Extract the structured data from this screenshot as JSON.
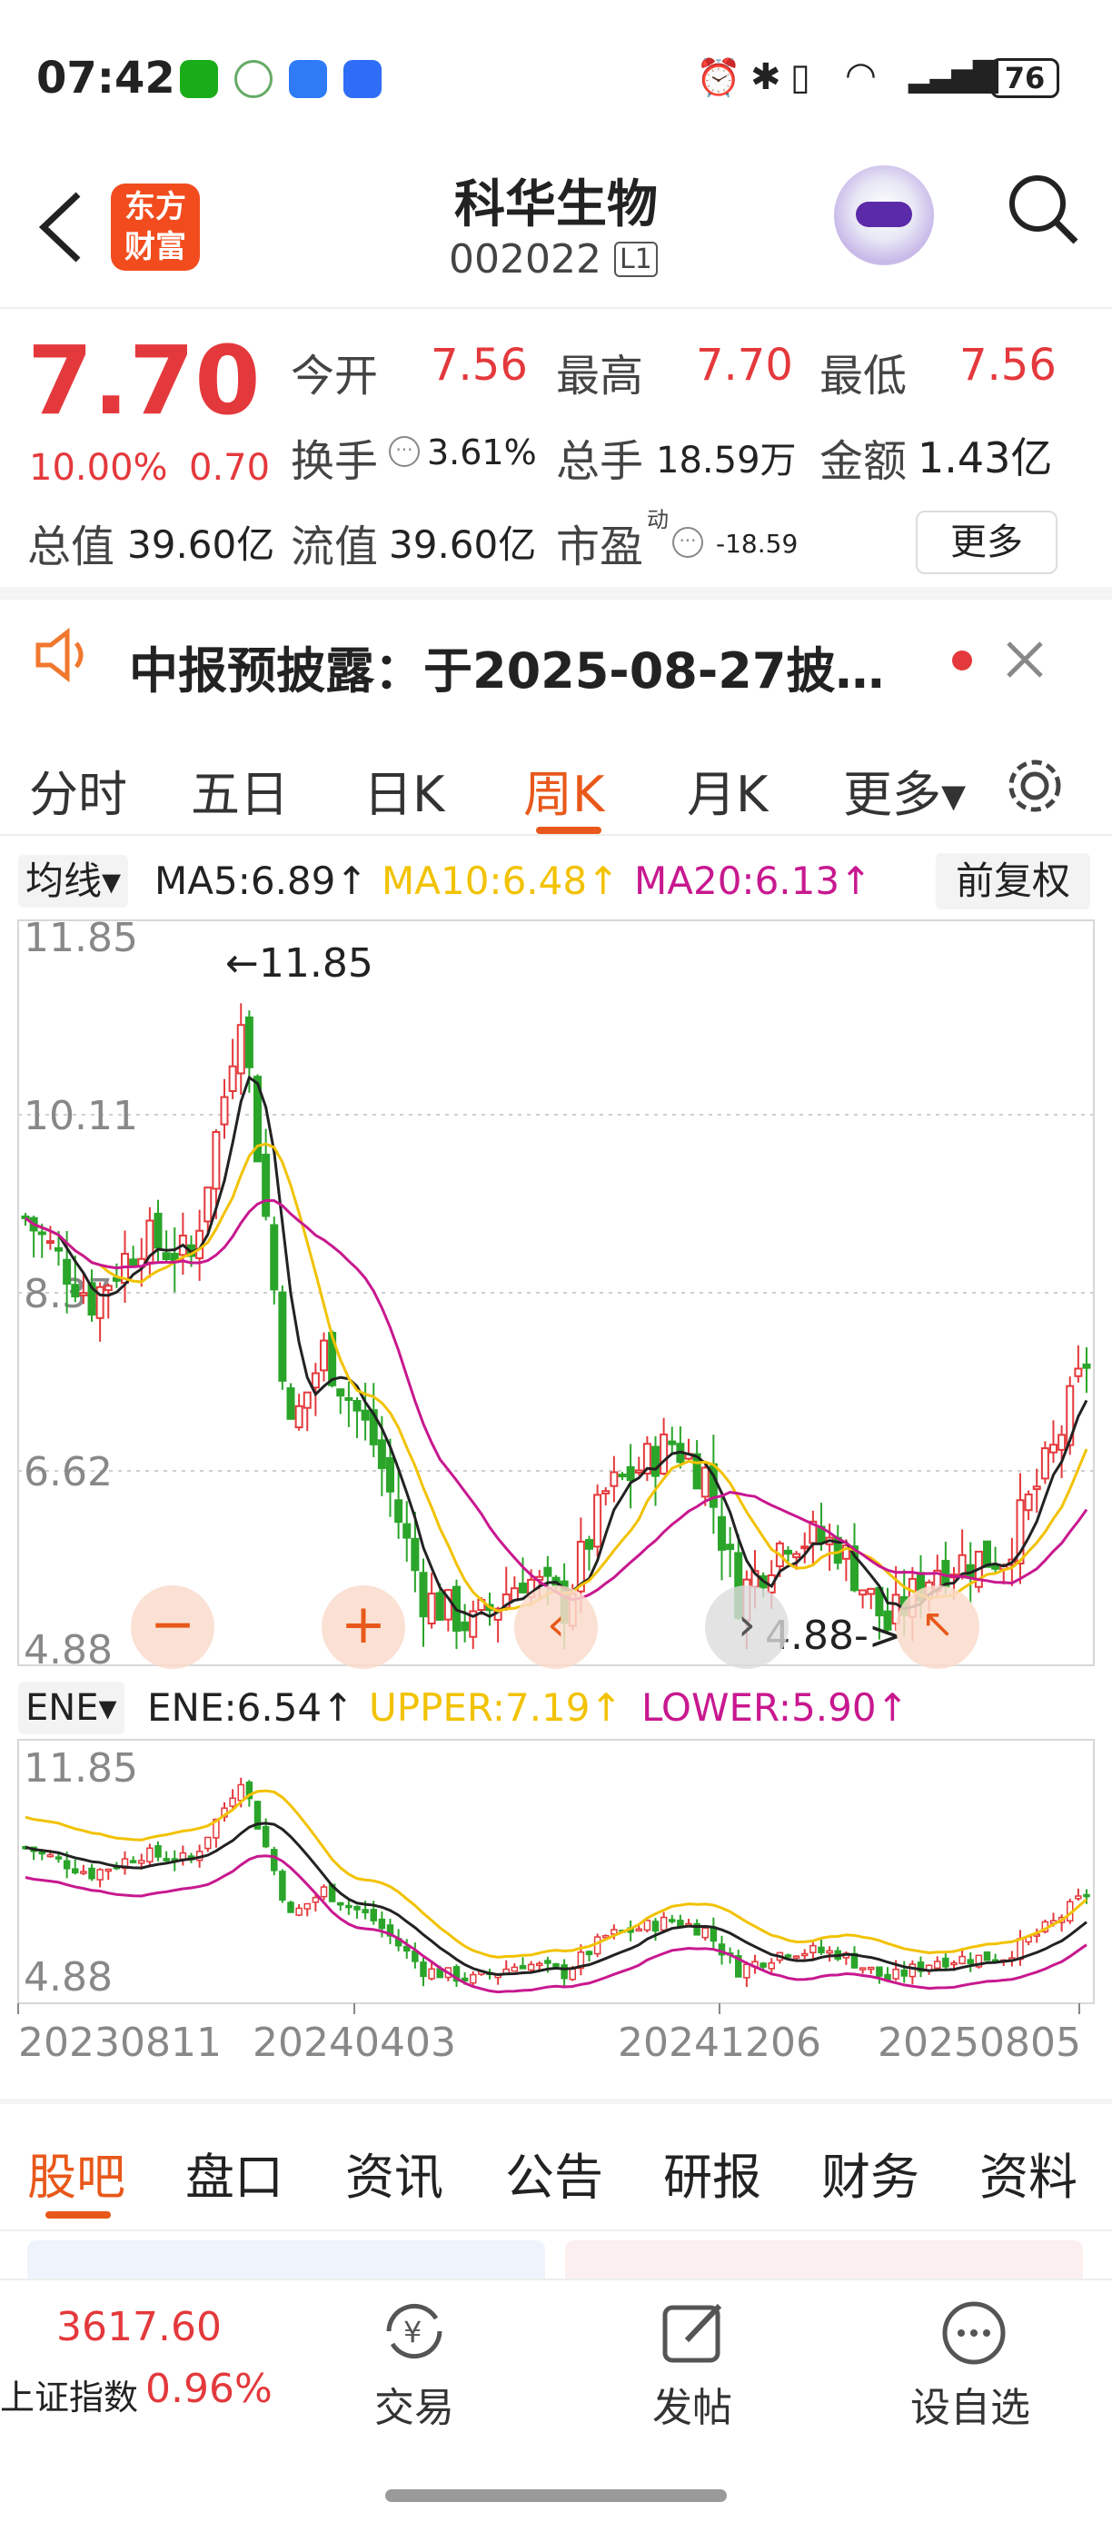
{
  "status": {
    "time": "07:42",
    "battery": "76"
  },
  "header": {
    "logo_line1": "东方",
    "logo_line2": "财富",
    "name": "科华生物",
    "code": "002022",
    "level": "L1"
  },
  "quote": {
    "price": "7.70",
    "pct": "10.00%",
    "chg": "0.70",
    "open_label": "今开",
    "open": "7.56",
    "high_label": "最高",
    "high": "7.70",
    "low_label": "最低",
    "low": "7.56",
    "turnover_label": "换手",
    "turnover": "3.61%",
    "vol_label": "总手",
    "vol": "18.59万",
    "amount_label": "金额",
    "amount": "1.43亿",
    "mcap_label": "总值",
    "mcap": "39.60亿",
    "float_label": "流值",
    "float": "39.60亿",
    "pe_label": "市盈",
    "pe_sup": "动",
    "pe": "-18.59",
    "more": "更多"
  },
  "notice": {
    "text": "中报预披露：于2025-08-27披…"
  },
  "period_tabs": [
    "分时",
    "五日",
    "日K",
    "周K",
    "月K",
    "更多▾"
  ],
  "active_tab": "周K",
  "ma": {
    "selector": "均线▾",
    "ma5": "MA5:6.89↑",
    "ma10": "MA10:6.48↑",
    "ma20": "MA20:6.13↑",
    "adj": "前复权"
  },
  "ene": {
    "selector": "ENE▾",
    "ene": "ENE:6.54↑",
    "upper": "UPPER:7.19↑",
    "lower": "LOWER:5.90↑"
  },
  "chart_data": {
    "type": "candlestick",
    "y_ticks": [
      "11.85",
      "10.11",
      "8.37",
      "6.62",
      "4.88"
    ],
    "sub_y_ticks": [
      "11.85",
      "4.88"
    ],
    "x_ticks": [
      "20230811",
      "20240403",
      "20241206",
      "20250805"
    ],
    "max_label": "←11.85",
    "min_label": "4.88->",
    "ylim": [
      4.88,
      11.85
    ],
    "colors": {
      "up": "#e4393c",
      "down": "#2aa52a",
      "ma5": "#222222",
      "ma10": "#f2c200",
      "ma20": "#c8188f"
    }
  },
  "bottom_tabs": [
    "股吧",
    "盘口",
    "资讯",
    "公告",
    "研报",
    "财务",
    "资料"
  ],
  "nav": {
    "index_value": "3617.60",
    "index_name": "上证指数",
    "index_pct": "0.96%",
    "trade": "交易",
    "post": "发帖",
    "fav": "设自选"
  }
}
